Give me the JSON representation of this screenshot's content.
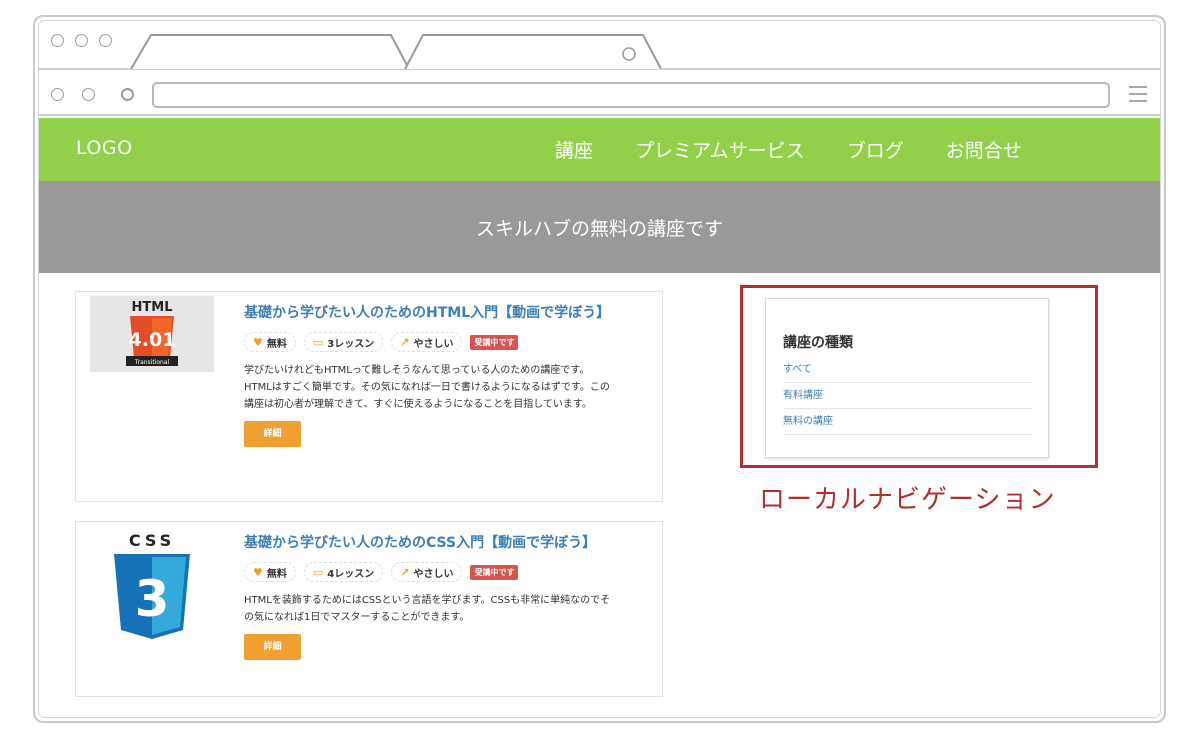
{
  "site": {
    "logo": "LOGO",
    "nav": [
      "講座",
      "プレミアムサービス",
      "ブログ",
      "お問合せ"
    ],
    "hero": "スキルハブの無料の講座です"
  },
  "courses": [
    {
      "thumb_title": "HTML",
      "thumb_version": "4.01",
      "thumb_sub": "Transitional",
      "title": "基礎から学びたい人のためのHTML入門【動画で学ぼう】",
      "tags": {
        "price": "無料",
        "lessons": "3レッスン",
        "level": "やさしい",
        "status": "受講中です"
      },
      "description": "学びたいけれどもHTMLって難しそうなんて思っている人のための講座です。HTMLはすごく簡単です。その気になれば一日で書けるようになるはずです。この講座は初心者が理解できて、すぐに使えるようになることを目指しています。",
      "button": "詳細"
    },
    {
      "thumb_title": "CSS",
      "thumb_version": "3",
      "title": "基礎から学びたい人のためのCSS入門【動画で学ぼう】",
      "tags": {
        "price": "無料",
        "lessons": "4レッスン",
        "level": "やさしい",
        "status": "受講中です"
      },
      "description": "HTMLを装飾するためにはCSSという言語を学びます。CSSも非常に単純なのでその気になれば1日でマスターすることができます。",
      "button": "詳細"
    }
  ],
  "sidebar": {
    "title": "講座の種類",
    "items": [
      "すべて",
      "有料講座",
      "無料の講座"
    ]
  },
  "annotation": "ローカルナビゲーション",
  "colors": {
    "header": "#92d04c",
    "hero": "#999999",
    "link": "#3d7fb6",
    "button": "#f0a030",
    "badge": "#d9534f",
    "annotation": "#b03030"
  }
}
